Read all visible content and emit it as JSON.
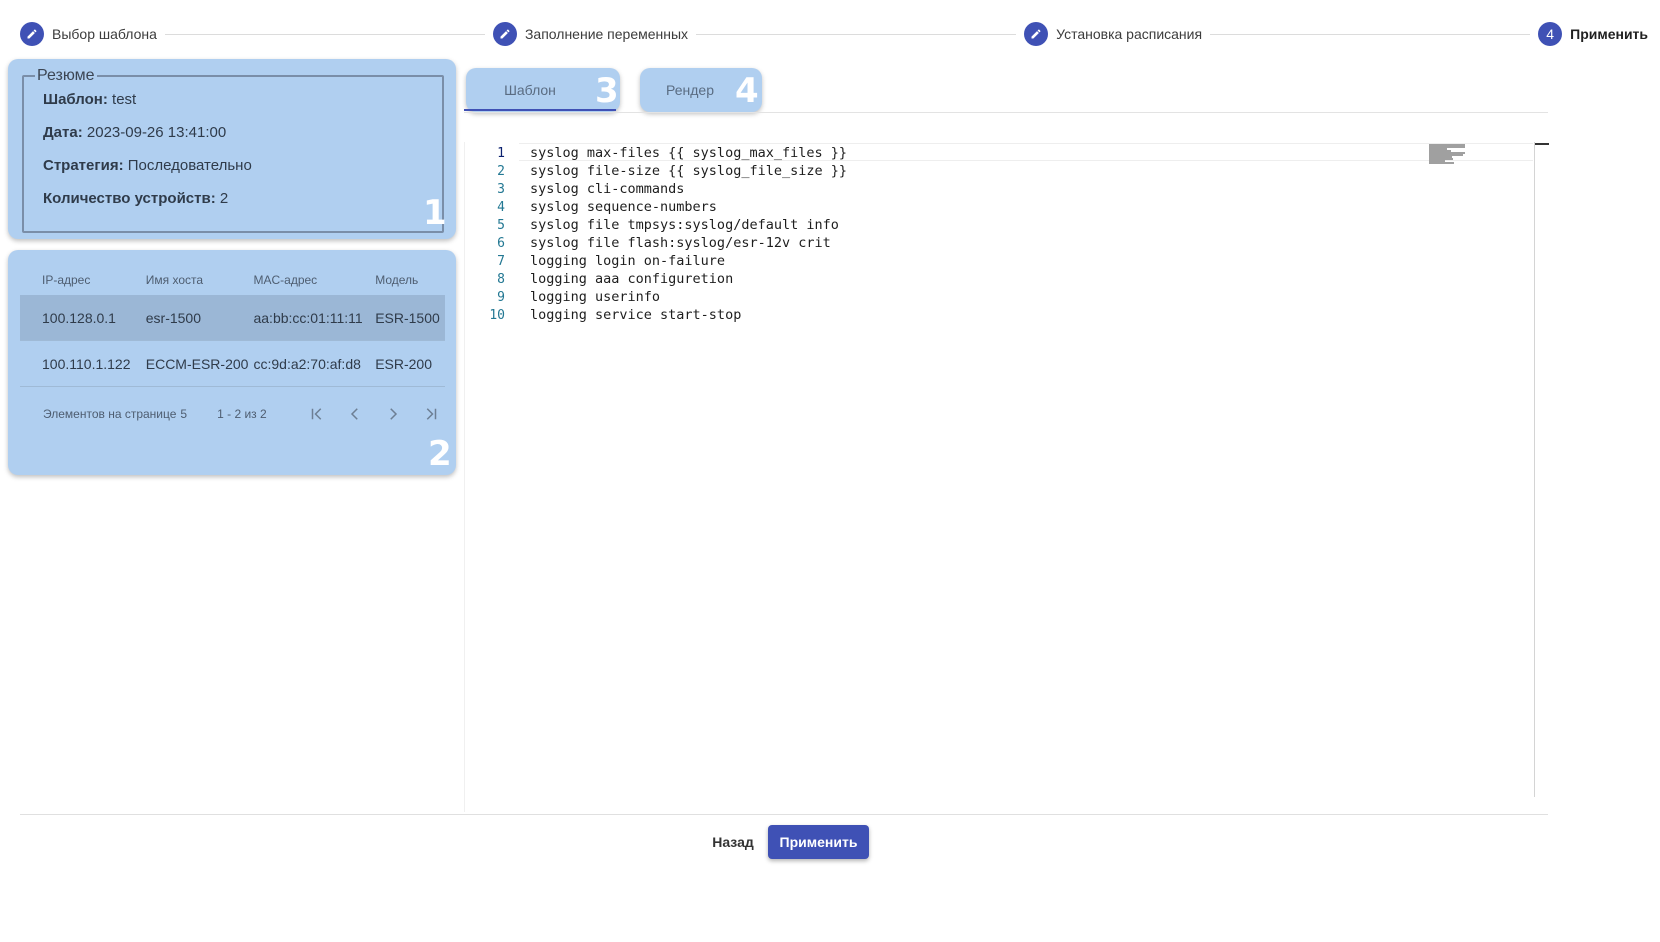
{
  "stepper": {
    "steps": [
      {
        "label": "Выбор шаблона",
        "icon": "pencil-icon",
        "state": "done"
      },
      {
        "label": "Заполнение переменных",
        "icon": "pencil-icon",
        "state": "done"
      },
      {
        "label": "Установка расписания",
        "icon": "pencil-icon",
        "state": "done"
      },
      {
        "label": "Применить",
        "number": "4",
        "state": "active"
      }
    ]
  },
  "summary": {
    "legend": "Резюме",
    "template_label": "Шаблон:",
    "template_value": "test",
    "date_label": "Дата:",
    "date_value": "2023-09-26 13:41:00",
    "strategy_label": "Стратегия:",
    "strategy_value": "Последовательно",
    "devices_count_label": "Количество устройств:",
    "devices_count_value": "2",
    "badge": "1"
  },
  "devices": {
    "columns": [
      "IP-адрес",
      "Имя хоста",
      "MAC-адрес",
      "Модель"
    ],
    "rows": [
      {
        "ip": "100.128.0.1",
        "host": "esr-1500",
        "mac": "aa:bb:cc:01:11:11",
        "model": "ESR-1500",
        "selected": true
      },
      {
        "ip": "100.110.1.122",
        "host": "ECCM-ESR-200",
        "mac": "cc:9d:a2:70:af:d8",
        "model": "ESR-200",
        "selected": false
      }
    ],
    "pager": {
      "page_size_label": "Элементов на странице",
      "page_size": "5",
      "range": "1 - 2 из 2"
    },
    "badge": "2"
  },
  "tabs": [
    {
      "label": "Шаблон",
      "badge": "3",
      "active": true
    },
    {
      "label": "Рендер",
      "badge": "4",
      "active": false
    }
  ],
  "editor": {
    "lines": [
      "syslog max-files {{ syslog_max_files }}",
      "syslog file-size {{ syslog_file_size }}",
      "syslog cli-commands",
      "syslog sequence-numbers",
      "syslog file tmpsys:syslog/default info",
      "syslog file flash:syslog/esr-12v crit",
      "logging login on-failure",
      "logging aaa configuretion",
      "logging userinfo",
      "logging service start-stop"
    ],
    "line_numbers": [
      "1",
      "2",
      "3",
      "4",
      "5",
      "6",
      "7",
      "8",
      "9",
      "10"
    ]
  },
  "footer": {
    "back_label": "Назад",
    "apply_label": "Применить"
  },
  "colors": {
    "primary": "#3f51b5",
    "card": "#b0cff0",
    "selected_row": "#9bb7d6"
  }
}
